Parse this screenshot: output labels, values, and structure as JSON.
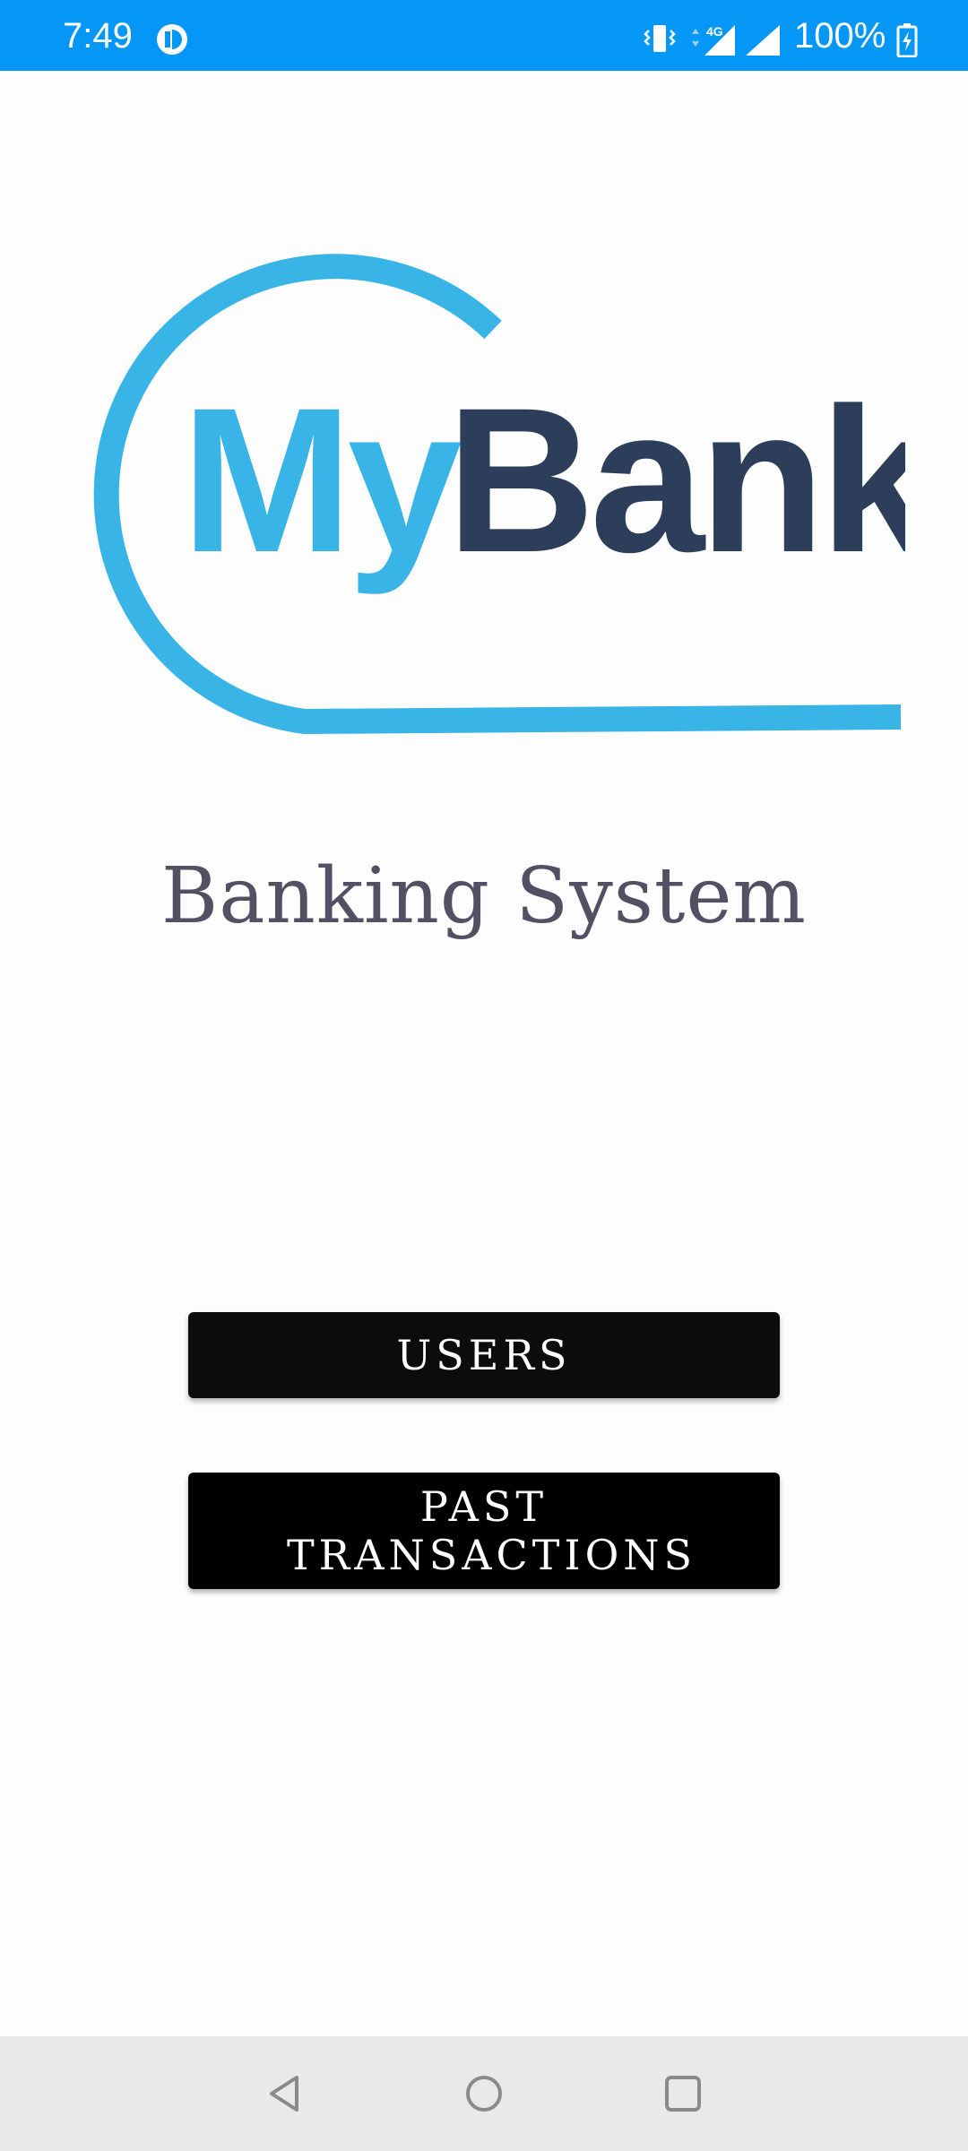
{
  "status_bar": {
    "time": "7:49",
    "network_label": "4G",
    "battery_percent": "100%",
    "background_color": "#0497f6"
  },
  "logo": {
    "wordmark_part1": "My",
    "wordmark_part2": "Bank",
    "primary_color": "#38b4e6",
    "secondary_color": "#2c3e5a"
  },
  "main": {
    "title": "Banking System",
    "users_button": "USERS",
    "past_transactions_button": "PAST TRANSACTIONS"
  },
  "nav_bar": {
    "icons": [
      "back-icon",
      "home-icon",
      "recents-icon"
    ]
  }
}
